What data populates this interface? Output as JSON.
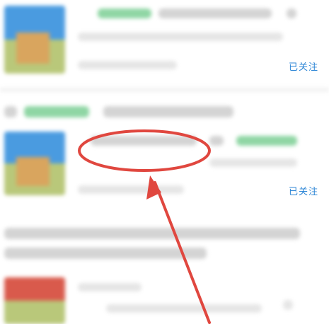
{
  "items": [
    {
      "follow_label": "已关注"
    },
    {
      "follow_label": "已关注"
    }
  ],
  "annotation": {
    "circle_color": "#e0473f",
    "arrow_color": "#e0473f"
  },
  "colors": {
    "follow_text": "#2d86d6",
    "tag_green": "#8fd6a4"
  }
}
